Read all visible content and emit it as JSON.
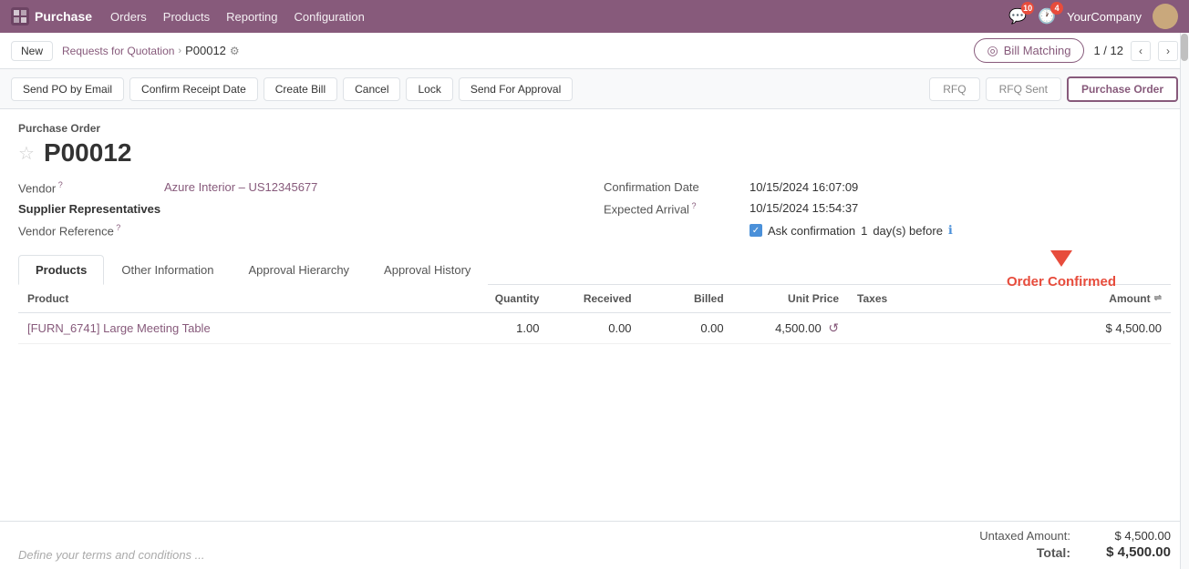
{
  "topnav": {
    "brand": "Purchase",
    "links": [
      "Orders",
      "Products",
      "Reporting",
      "Configuration"
    ],
    "notifications_count": "10",
    "messages_count": "4",
    "company": "YourCompany"
  },
  "breadcrumb": {
    "new_label": "New",
    "crumb_link": "Requests for Quotation",
    "current": "P00012",
    "bill_matching": "Bill Matching",
    "pagination": "1 / 12"
  },
  "actions": {
    "send_po": "Send PO by Email",
    "confirm_receipt": "Confirm Receipt Date",
    "create_bill": "Create Bill",
    "cancel": "Cancel",
    "lock": "Lock",
    "send_approval": "Send For Approval",
    "status_rfq": "RFQ",
    "status_rfq_sent": "RFQ Sent",
    "status_purchase_order": "Purchase Order"
  },
  "document": {
    "type_label": "Purchase Order",
    "number": "P00012",
    "vendor_label": "Vendor",
    "vendor_value": "Azure Interior – US12345677",
    "supplier_rep_label": "Supplier Representatives",
    "vendor_ref_label": "Vendor Reference",
    "confirmation_date_label": "Confirmation Date",
    "confirmation_date_value": "10/15/2024 16:07:09",
    "expected_arrival_label": "Expected Arrival",
    "expected_arrival_value": "10/15/2024 15:54:37",
    "ask_confirmation_label": "Ask confirmation",
    "ask_confirmation_days": "1",
    "days_before_label": "day(s) before",
    "order_confirmed": "Order Confirmed"
  },
  "tabs": [
    {
      "id": "products",
      "label": "Products",
      "active": true
    },
    {
      "id": "other-information",
      "label": "Other Information",
      "active": false
    },
    {
      "id": "approval-hierarchy",
      "label": "Approval Hierarchy",
      "active": false
    },
    {
      "id": "approval-history",
      "label": "Approval History",
      "active": false
    }
  ],
  "table": {
    "headers": {
      "product": "Product",
      "quantity": "Quantity",
      "received": "Received",
      "billed": "Billed",
      "unit_price": "Unit Price",
      "taxes": "Taxes",
      "amount": "Amount"
    },
    "rows": [
      {
        "product_code": "[FURN_6741]",
        "product_name": "Large Meeting Table",
        "quantity": "1.00",
        "received": "0.00",
        "billed": "0.00",
        "unit_price": "4,500.00",
        "taxes": "",
        "amount": "$ 4,500.00"
      }
    ]
  },
  "footer": {
    "terms_placeholder": "Define your terms and conditions ...",
    "untaxed_label": "Untaxed Amount:",
    "untaxed_value": "$ 4,500.00",
    "total_label": "Total:",
    "total_value": "$ 4,500.00"
  }
}
